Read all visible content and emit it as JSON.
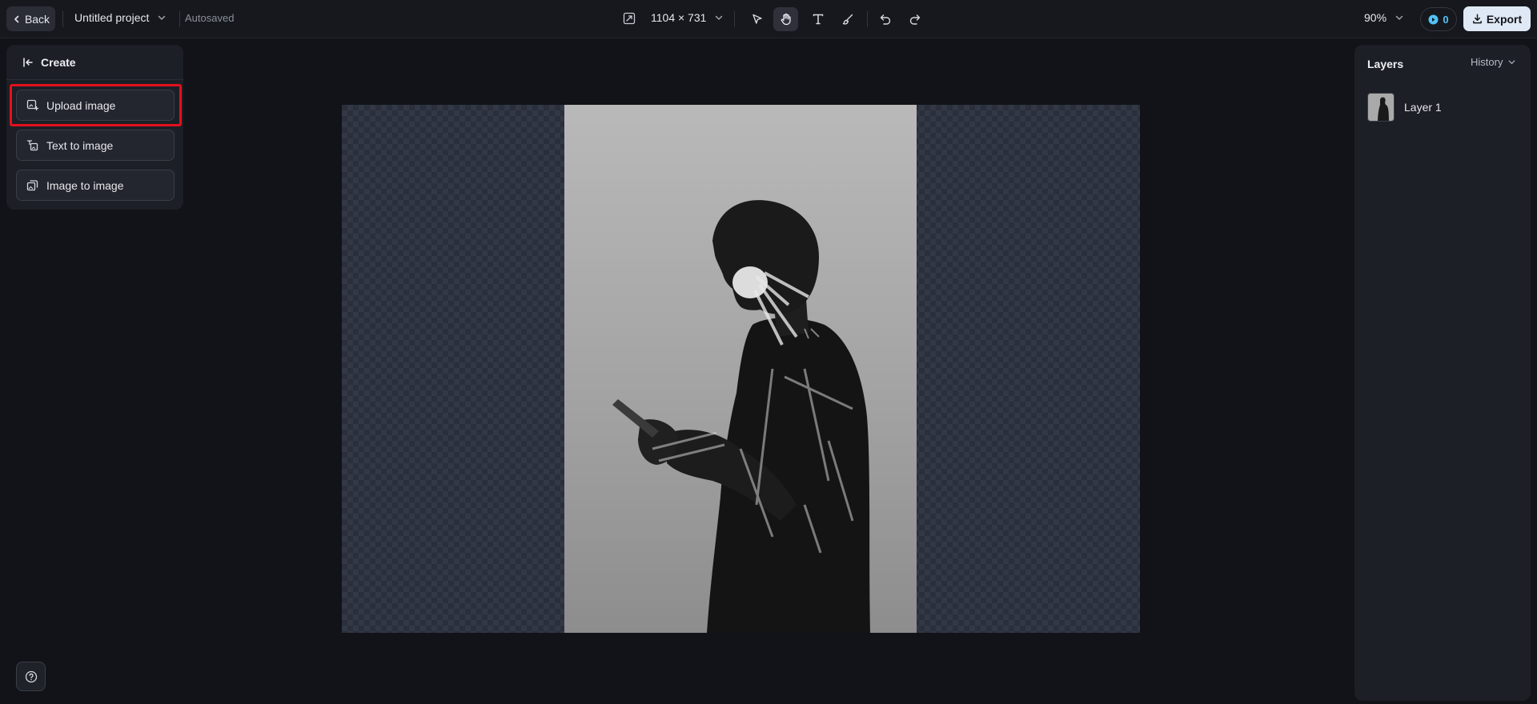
{
  "topbar": {
    "back_label": "Back",
    "project_name": "Untitled project",
    "autosaved": "Autosaved",
    "canvas_size": "1104 × 731",
    "zoom": "90%",
    "credits": "0",
    "export_label": "Export"
  },
  "tools": [
    {
      "name": "select-tool",
      "icon": "cursor-arrow-icon",
      "active": false
    },
    {
      "name": "hand-tool",
      "icon": "hand-icon",
      "active": true
    },
    {
      "name": "text-tool",
      "icon": "text-t-icon",
      "active": false
    },
    {
      "name": "brush-tool",
      "icon": "brush-icon",
      "active": false
    },
    {
      "name": "undo-button",
      "icon": "undo-icon",
      "active": false
    },
    {
      "name": "redo-button",
      "icon": "redo-icon",
      "active": false
    }
  ],
  "create_panel": {
    "title": "Create",
    "options": [
      {
        "label": "Upload image",
        "icon": "upload-image-icon",
        "highlighted": true
      },
      {
        "label": "Text to image",
        "icon": "text-to-image-icon",
        "highlighted": false
      },
      {
        "label": "Image to image",
        "icon": "image-to-image-icon",
        "highlighted": false
      }
    ]
  },
  "layers_panel": {
    "title": "Layers",
    "history_label": "History",
    "layers": [
      {
        "label": "Layer 1"
      }
    ]
  },
  "colors": {
    "background": "#111318",
    "panel": "#1c1f26",
    "highlight": "#e5101c",
    "export_bg": "#dfe9f5",
    "credit_accent": "#4fc3f7"
  }
}
